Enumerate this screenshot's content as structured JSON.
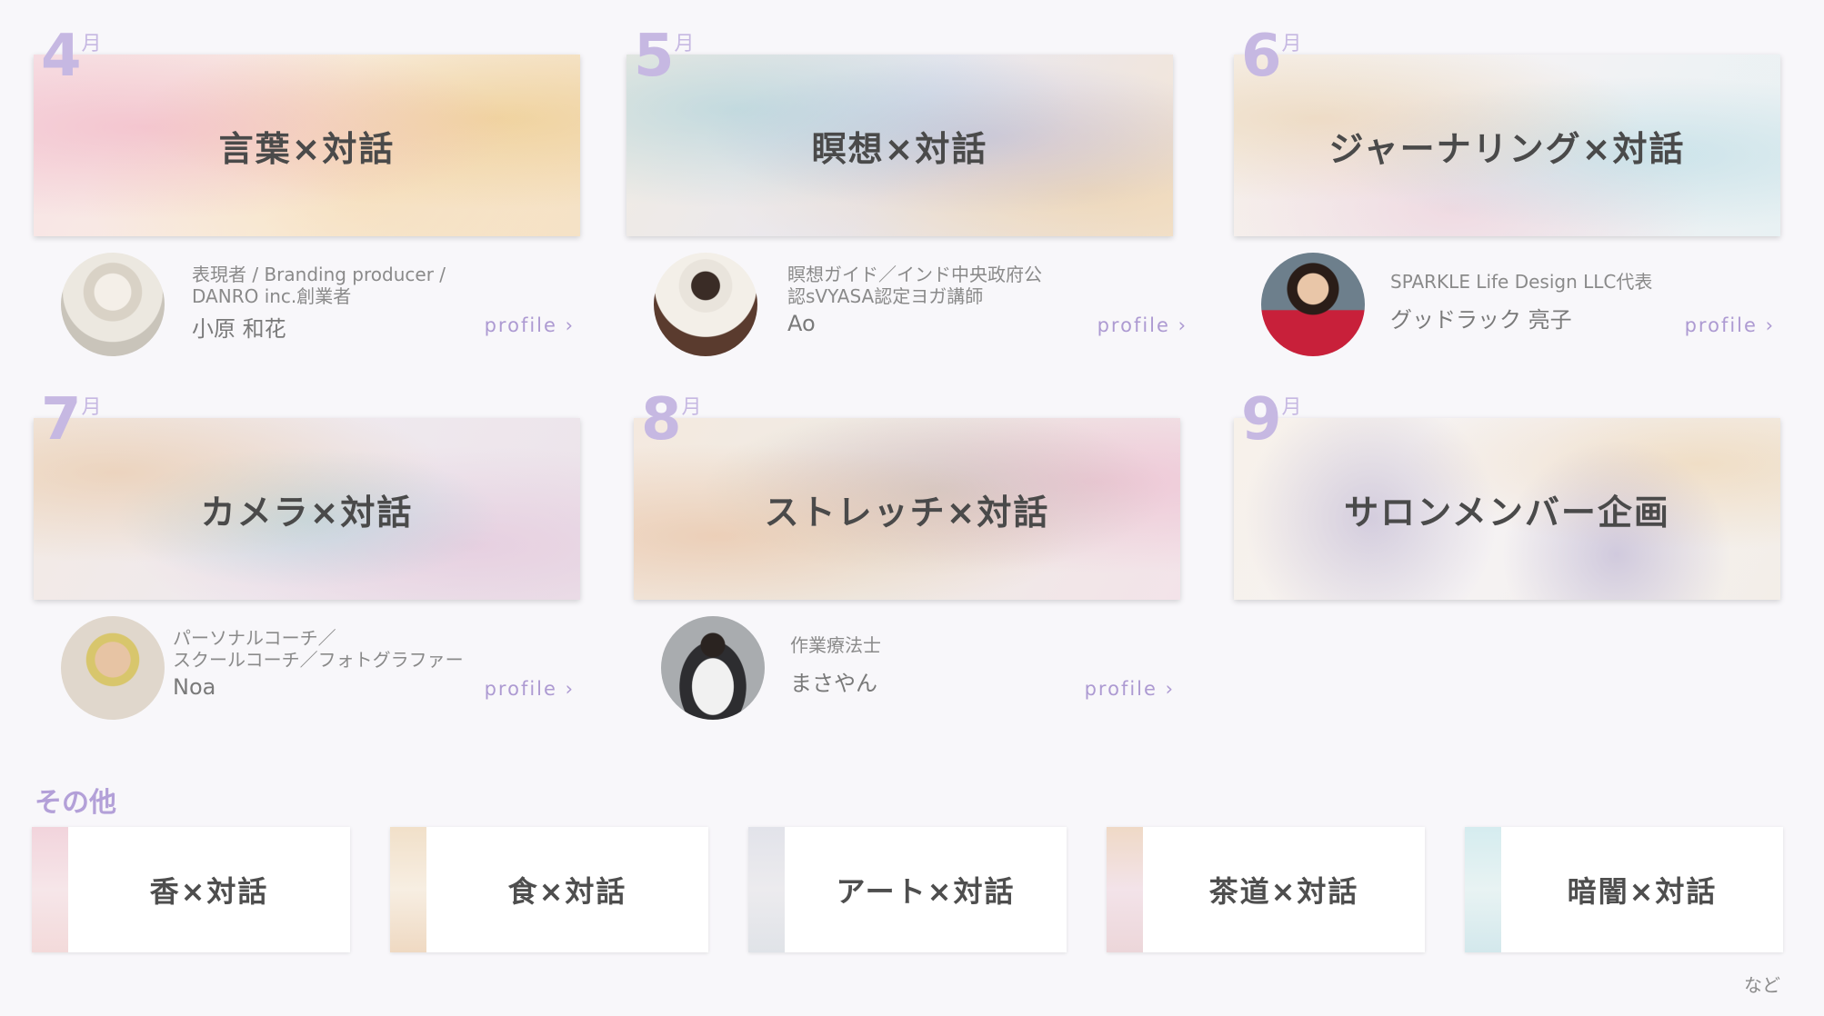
{
  "months": [
    {
      "num": "4",
      "unit": "月",
      "title": "言葉×対話",
      "role": "表現者 / Branding producer /\nDANRO inc.創業者",
      "name": "小原 和花",
      "profile": "profile ›"
    },
    {
      "num": "5",
      "unit": "月",
      "title": "瞑想×対話",
      "role": "瞑想ガイド／インド中央政府公\n認sVYASA認定ヨガ講師",
      "name": "Ao",
      "profile": "profile ›"
    },
    {
      "num": "6",
      "unit": "月",
      "title": "ジャーナリング×対話",
      "role": "SPARKLE Life Design LLC代表",
      "name": "グッドラック 亮子",
      "profile": "profile ›"
    },
    {
      "num": "7",
      "unit": "月",
      "title": "カメラ×対話",
      "role": "パーソナルコーチ／\nスクールコーチ／フォトグラファー",
      "name": "Noa",
      "profile": "profile ›"
    },
    {
      "num": "8",
      "unit": "月",
      "title": "ストレッチ×対話",
      "role": "作業療法士",
      "name": "まさやん",
      "profile": "profile ›"
    },
    {
      "num": "9",
      "unit": "月",
      "title": "サロンメンバー企画"
    }
  ],
  "others": {
    "label": "その他",
    "items": [
      "香×対話",
      "食×対話",
      "アート×対話",
      "茶道×対話",
      "暗闇×対話"
    ],
    "etc": "など"
  },
  "colors": {
    "accent": "#b3a0d8",
    "month": "#c6b8e2",
    "title": "#4a4a4a"
  }
}
